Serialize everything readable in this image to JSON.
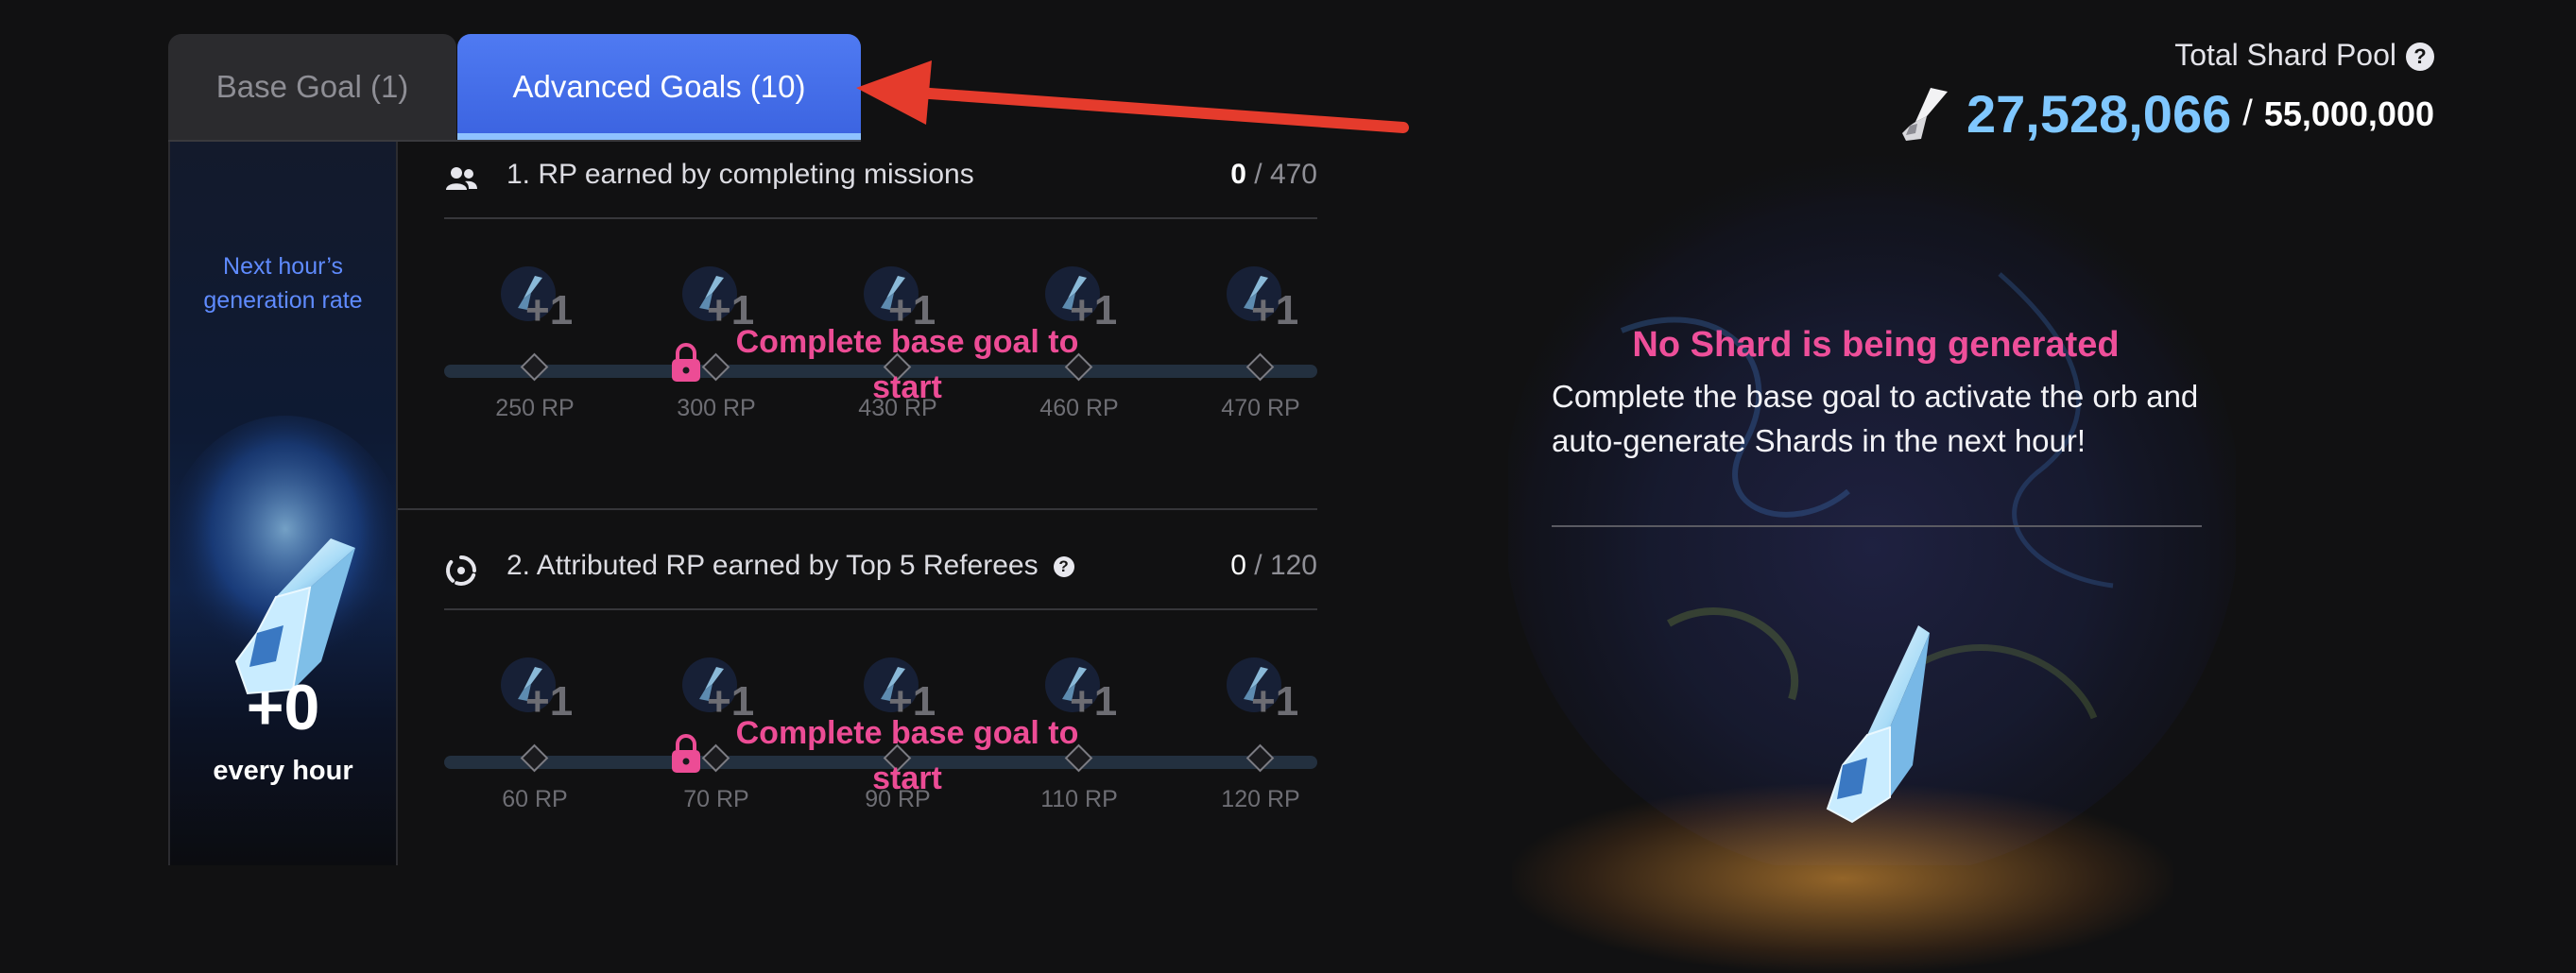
{
  "tabs": [
    {
      "label": "Base Goal (1)",
      "active": false
    },
    {
      "label": "Advanced Goals (10)",
      "active": true
    }
  ],
  "generation": {
    "label": "Next hour’s generation rate",
    "value": "+0",
    "unit": "every hour"
  },
  "goals": [
    {
      "title": "1. RP earned by completing missions",
      "icon": "users-icon",
      "current": "0",
      "separator": " / ",
      "target": "470",
      "lock_text": "Complete base goal to start",
      "milestones": [
        {
          "reward": "+1",
          "label": "250 RP"
        },
        {
          "reward": "+1",
          "label": "300 RP"
        },
        {
          "reward": "+1",
          "label": "430 RP"
        },
        {
          "reward": "+1",
          "label": "460 RP"
        },
        {
          "reward": "+1",
          "label": "470 RP"
        }
      ]
    },
    {
      "title": "2. Attributed RP earned by Top 5 Referees",
      "icon": "swirl-icon",
      "has_help": true,
      "current": "0",
      "separator": " / ",
      "target": "120",
      "lock_text": "Complete base goal to start",
      "milestones": [
        {
          "reward": "+1",
          "label": "60 RP"
        },
        {
          "reward": "+1",
          "label": "70 RP"
        },
        {
          "reward": "+1",
          "label": "90 RP"
        },
        {
          "reward": "+1",
          "label": "110 RP"
        },
        {
          "reward": "+1",
          "label": "120 RP"
        }
      ]
    }
  ],
  "pool": {
    "label": "Total Shard Pool",
    "current": "27,528,066",
    "separator": "/",
    "max": "55,000,000"
  },
  "orb": {
    "title": "No Shard is being generated",
    "text": "Complete the base goal to activate the orb and auto-generate Shards in the next hour!"
  },
  "colors": {
    "accent": "#4a72f0",
    "pool_value": "#7fc7ff",
    "warning_pink": "#ec4c95",
    "arrow": "#e53b2c"
  }
}
